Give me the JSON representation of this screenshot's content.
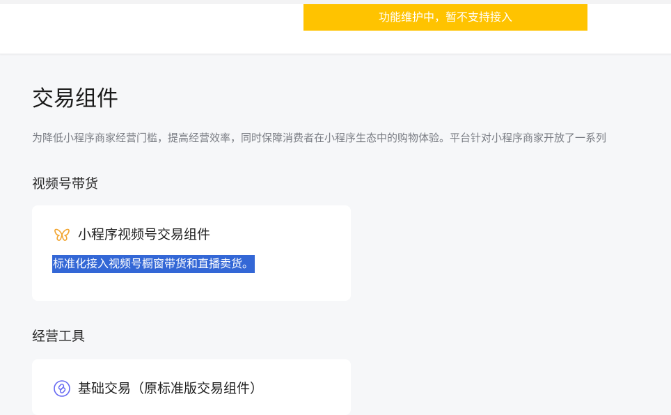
{
  "header": {
    "notice": "功能维护中，暂不支持接入"
  },
  "page": {
    "title": "交易组件",
    "description": "为降低小程序商家经营门槛，提高经营效率，同时保障消费者在小程序生态中的购物体验。平台针对小程序商家开放了一系列"
  },
  "sections": [
    {
      "title": "视频号带货",
      "card": {
        "icon": "butterfly-icon",
        "title": "小程序视频号交易组件",
        "description": "标准化接入视频号橱窗带货和直播卖货。"
      }
    },
    {
      "title": "经营工具",
      "card": {
        "icon": "link-icon",
        "title": "基础交易（原标准版交易组件）"
      }
    }
  ],
  "colors": {
    "notice_bg": "#ffc300",
    "selection_bg": "#3367d6",
    "butterfly_icon": "#f2a531",
    "link_icon": "#6467f2"
  }
}
